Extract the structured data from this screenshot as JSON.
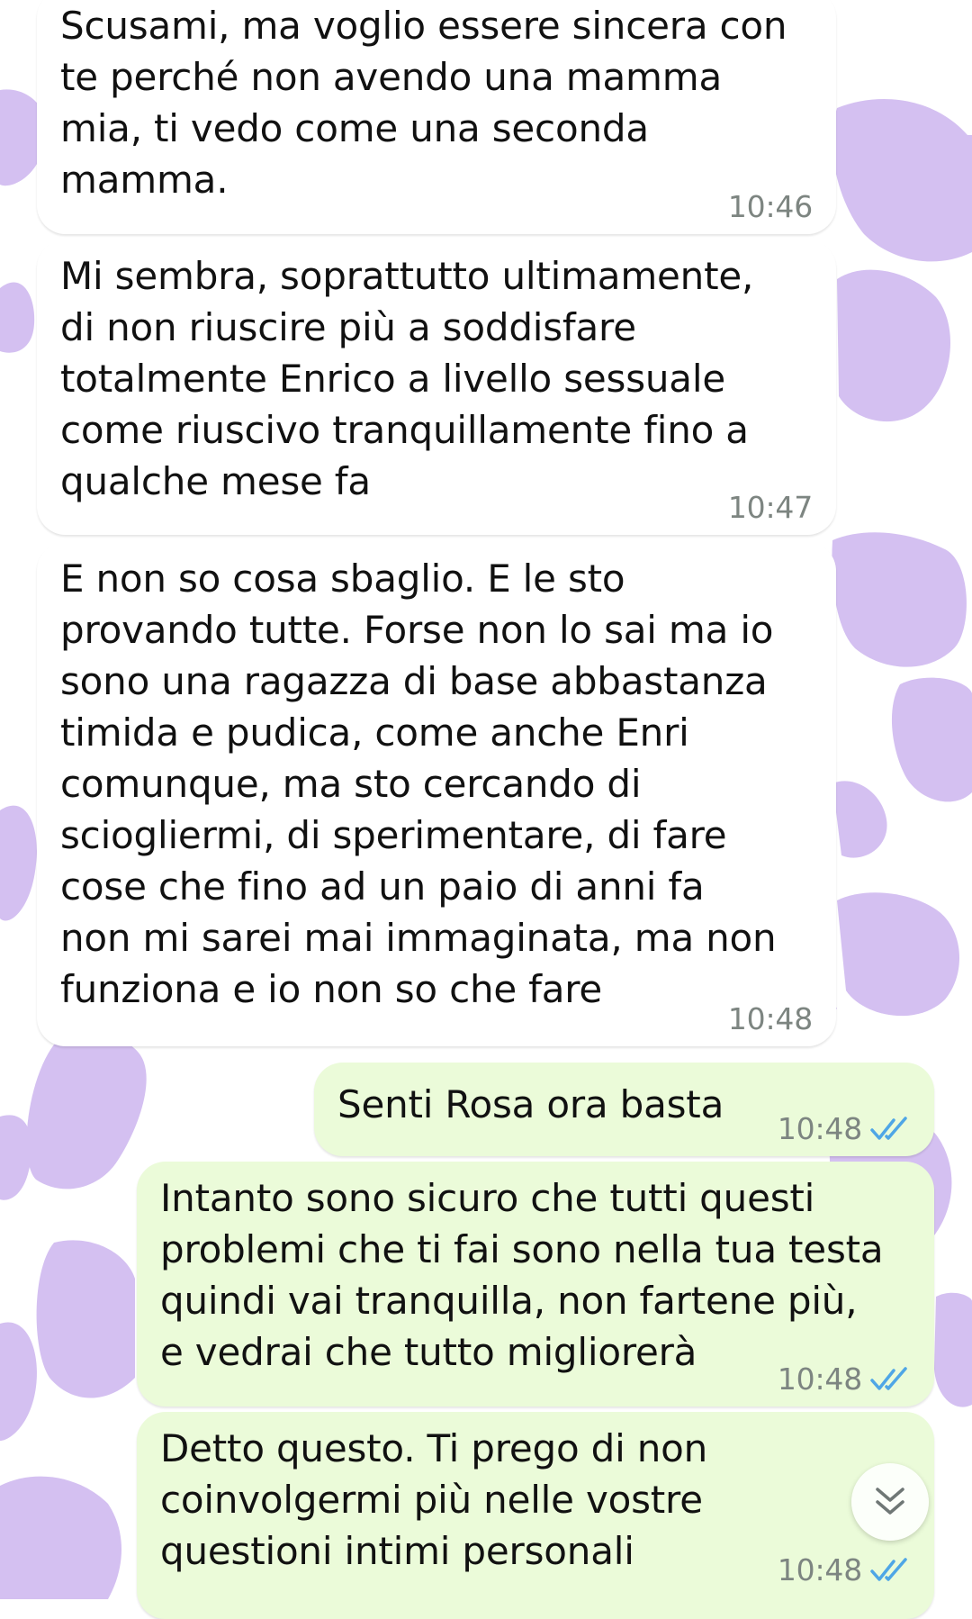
{
  "wallpaper": {
    "base_color": "#ffffff",
    "spot_color": "#d4c0f1",
    "pattern": "cow-spots"
  },
  "colors": {
    "incoming_bubble": "#ffffff",
    "outgoing_bubble": "#ebfbd9",
    "read_tick": "#4fa6e6",
    "timestamp": "#7d8581"
  },
  "messages": [
    {
      "direction": "incoming",
      "text": "Scusami, ma voglio essere sincera con\nte perché non avendo una mamma\nmia, ti vedo come una seconda\nmamma.",
      "time": "10:46"
    },
    {
      "direction": "incoming",
      "text": "Mi sembra, soprattutto ultimamente,\ndi non riuscire più a soddisfare\ntotalmente Enrico a livello sessuale\ncome riuscivo tranquillamente fino a\nqualche mese fa",
      "time": "10:47"
    },
    {
      "direction": "incoming",
      "text": "E non so cosa sbaglio. E le sto\nprovando tutte. Forse non lo sai ma io\nsono una ragazza di base abbastanza\ntimida e pudica, come anche Enri\ncomunque, ma sto cercando di\nsciogliermi, di sperimentare, di fare\ncose che fino ad un paio di anni fa\nnon mi sarei mai immaginata, ma non\nfunziona e io non so che fare",
      "time": "10:48"
    },
    {
      "direction": "outgoing",
      "text": "Senti Rosa ora basta",
      "time": "10:48",
      "status": "read"
    },
    {
      "direction": "outgoing",
      "text": "Intanto sono sicuro che tutti questi\nproblemi che ti fai sono nella tua testa\nquindi vai tranquilla, non fartene più,\ne vedrai che tutto migliorerà",
      "time": "10:48",
      "status": "read"
    },
    {
      "direction": "outgoing",
      "text": "Detto questo. Ti prego di non\ncoinvolgermi più nelle vostre\nquestioni intimi personali",
      "time": "10:48",
      "status": "read"
    }
  ],
  "scroll_button": {
    "icon": "double-chevron-down-icon"
  }
}
